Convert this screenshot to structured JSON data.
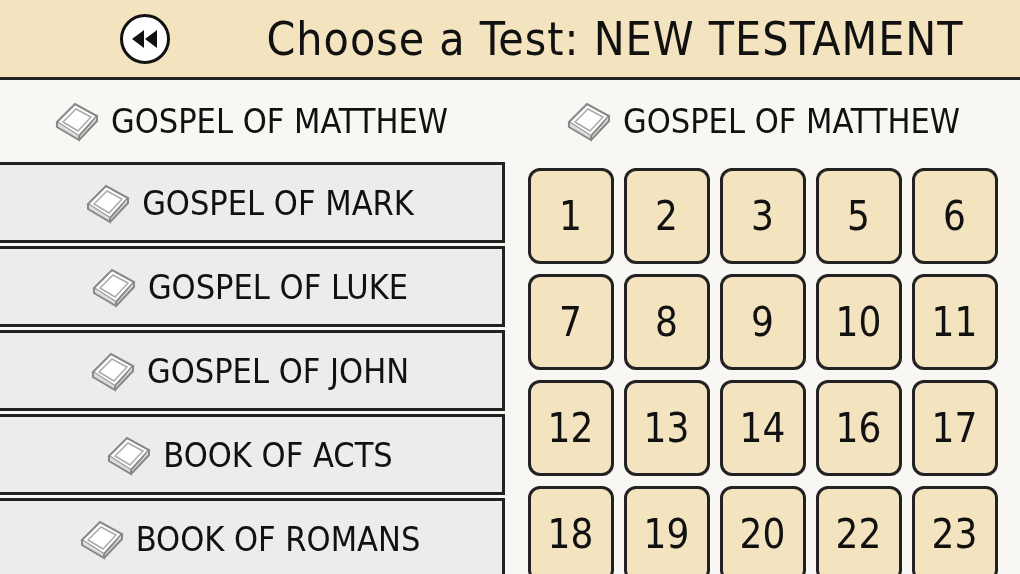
{
  "header": {
    "title": "Choose a Test: NEW TESTAMENT"
  },
  "books": [
    {
      "label": "GOSPEL OF MATTHEW",
      "selected": true
    },
    {
      "label": "GOSPEL OF MARK",
      "selected": false
    },
    {
      "label": "GOSPEL OF LUKE",
      "selected": false
    },
    {
      "label": "GOSPEL OF JOHN",
      "selected": false
    },
    {
      "label": "BOOK OF ACTS",
      "selected": false
    },
    {
      "label": "BOOK OF ROMANS",
      "selected": false
    }
  ],
  "tests": {
    "title": "GOSPEL OF MATTHEW",
    "items": [
      "1",
      "2",
      "3",
      "5",
      "6",
      "7",
      "8",
      "9",
      "10",
      "11",
      "12",
      "13",
      "14",
      "16",
      "17",
      "18",
      "19",
      "20",
      "22",
      "23"
    ]
  }
}
